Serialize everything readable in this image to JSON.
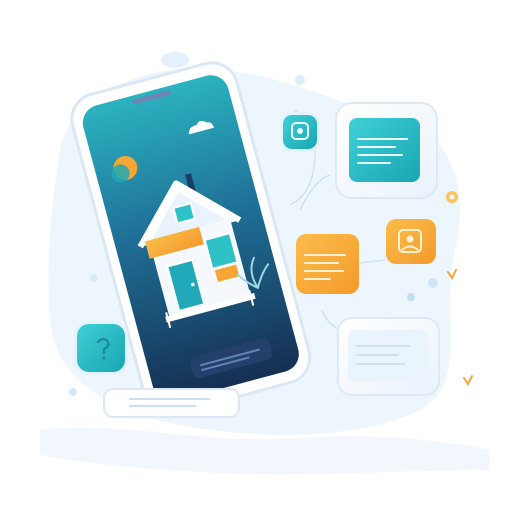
{
  "illustration": {
    "subject": "smartphone-with-house-app",
    "icons": [
      "home-icon",
      "chat-icon",
      "settings-icon",
      "message-icon",
      "sun-icon",
      "cloud-icon"
    ]
  },
  "colors": {
    "teal": "#1fb7c2",
    "teal_light": "#5fd3d9",
    "navy": "#153a5c",
    "deep_blue": "#1c4f7a",
    "orange": "#f7a534",
    "orange_light": "#f9c04f",
    "panel_bg": "#eef6fc",
    "panel_border": "#dbe8f4",
    "splash": "#e6f1fb",
    "white": "#ffffff"
  }
}
